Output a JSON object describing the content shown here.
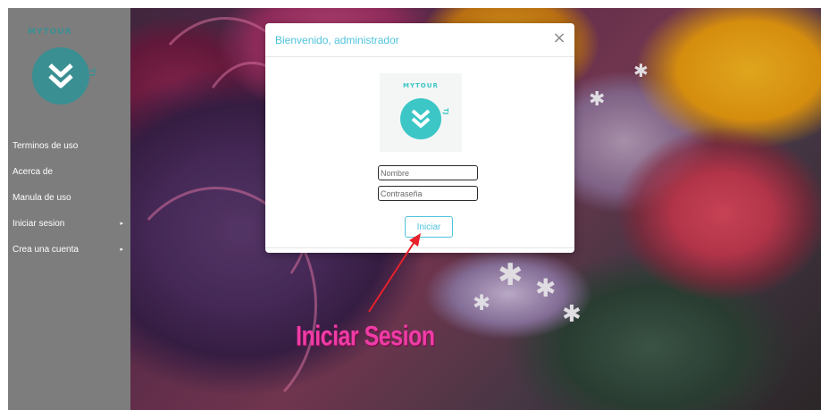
{
  "sidebar": {
    "brand": {
      "top_text": "MYTOUR",
      "side_text": "TJ"
    },
    "items": [
      {
        "label": "Terminos de uso",
        "has_submenu": false
      },
      {
        "label": "Acerca de",
        "has_submenu": false
      },
      {
        "label": "Manula de uso",
        "has_submenu": false
      },
      {
        "label": "Iniciar sesion",
        "has_submenu": true,
        "caret": "▸"
      },
      {
        "label": "Crea una cuenta",
        "has_submenu": true,
        "caret": "▸"
      }
    ]
  },
  "modal": {
    "title": "Bienvenido, administrador",
    "close_glyph": "×",
    "logo": {
      "top_text": "MYTOUR",
      "side_text": "TJ"
    },
    "name_placeholder": "Nombre",
    "password_placeholder": "Contraseña",
    "submit_label": "Iniciar"
  },
  "annotation": {
    "label": "Iniciar Sesion"
  },
  "colors": {
    "accent": "#4fc3dc",
    "brand_teal": "#3a8f93",
    "annotation_pink": "#f03ca6",
    "arrow_red": "#e8212b",
    "sidebar_overlay": "#7d7d7d"
  },
  "icons": {
    "logo": "double-chevron-down-icon",
    "close": "close-icon",
    "submenu": "caret-right-icon"
  }
}
